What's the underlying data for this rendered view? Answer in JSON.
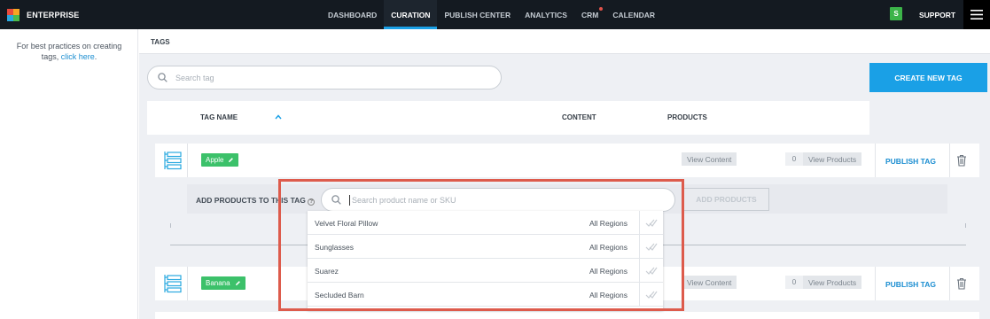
{
  "topbar": {
    "brand": "ENTERPRISE",
    "logo_colors": [
      "#e84c3d",
      "#f5a623",
      "#2aa9e0",
      "#4cbb4a"
    ],
    "nav": [
      {
        "label": "DASHBOARD",
        "active": false
      },
      {
        "label": "CURATION",
        "active": true
      },
      {
        "label": "PUBLISH CENTER",
        "active": false
      },
      {
        "label": "ANALYTICS",
        "active": false
      },
      {
        "label": "CRM",
        "active": false,
        "notification": true
      },
      {
        "label": "CALENDAR",
        "active": false
      }
    ],
    "user_badge": "S",
    "support": "SUPPORT"
  },
  "sidebar": {
    "help_text": "For best practices on creating tags, ",
    "help_link": "click here",
    "help_end": "."
  },
  "breadcrumb": "TAGS",
  "search": {
    "placeholder": "Search tag"
  },
  "create_button": "CREATE NEW TAG",
  "table_header": {
    "tag_name": "TAG NAME",
    "sort_icon": "chevron-up-icon",
    "content": "CONTENT",
    "products": "PRODUCTS"
  },
  "rows": [
    {
      "tag": "Apple",
      "view_content": "View Content",
      "count": "0",
      "view_products": "View Products",
      "publish": "PUBLISH TAG"
    },
    {
      "tag": "Banana",
      "view_content": "View Content",
      "count": "0",
      "view_products": "View Products",
      "publish": "PUBLISH TAG"
    }
  ],
  "add_products": {
    "label": "ADD PRODUCTS TO THIS TAG",
    "help_icon": "?",
    "placeholder": "Search product name or SKU",
    "button": "ADD PRODUCTS"
  },
  "dropdown": [
    {
      "name": "Velvet Floral Pillow",
      "region": "All Regions"
    },
    {
      "name": "Sunglasses",
      "region": "All Regions"
    },
    {
      "name": "Suarez",
      "region": "All Regions"
    },
    {
      "name": "Secluded Barn",
      "region": "All Regions"
    }
  ],
  "colors": {
    "accent": "#1aa0e6",
    "tag_green": "#3cc16a",
    "highlight_box": "#dd5b4c"
  }
}
